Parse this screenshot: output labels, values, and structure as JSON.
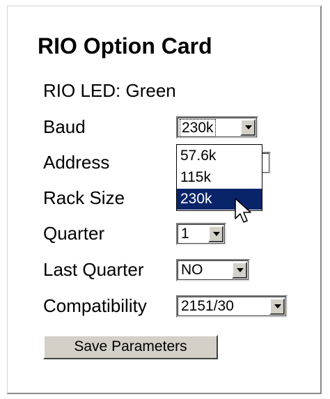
{
  "card": {
    "title": "RIO Option Card",
    "status_label": "RIO LED: Green"
  },
  "fields": {
    "baud": {
      "label": "Baud",
      "value": "230k",
      "options": [
        "57.6k",
        "115k",
        "230k"
      ],
      "selected": "230k"
    },
    "address": {
      "label": "Address"
    },
    "rack_size": {
      "label": "Rack Size"
    },
    "quarter": {
      "label": "Quarter",
      "value": "1"
    },
    "last_quarter": {
      "label": "Last Quarter",
      "value": "NO"
    },
    "compatibility": {
      "label": "Compatibility",
      "value": "2151/30"
    }
  },
  "actions": {
    "save_label": "Save Parameters"
  },
  "icons": {
    "dropdown_arrow": "chevron-down-icon",
    "cursor": "mouse-pointer-icon"
  },
  "colors": {
    "selection_highlight": "#0a246a",
    "button_face": "#d4d0c8"
  }
}
